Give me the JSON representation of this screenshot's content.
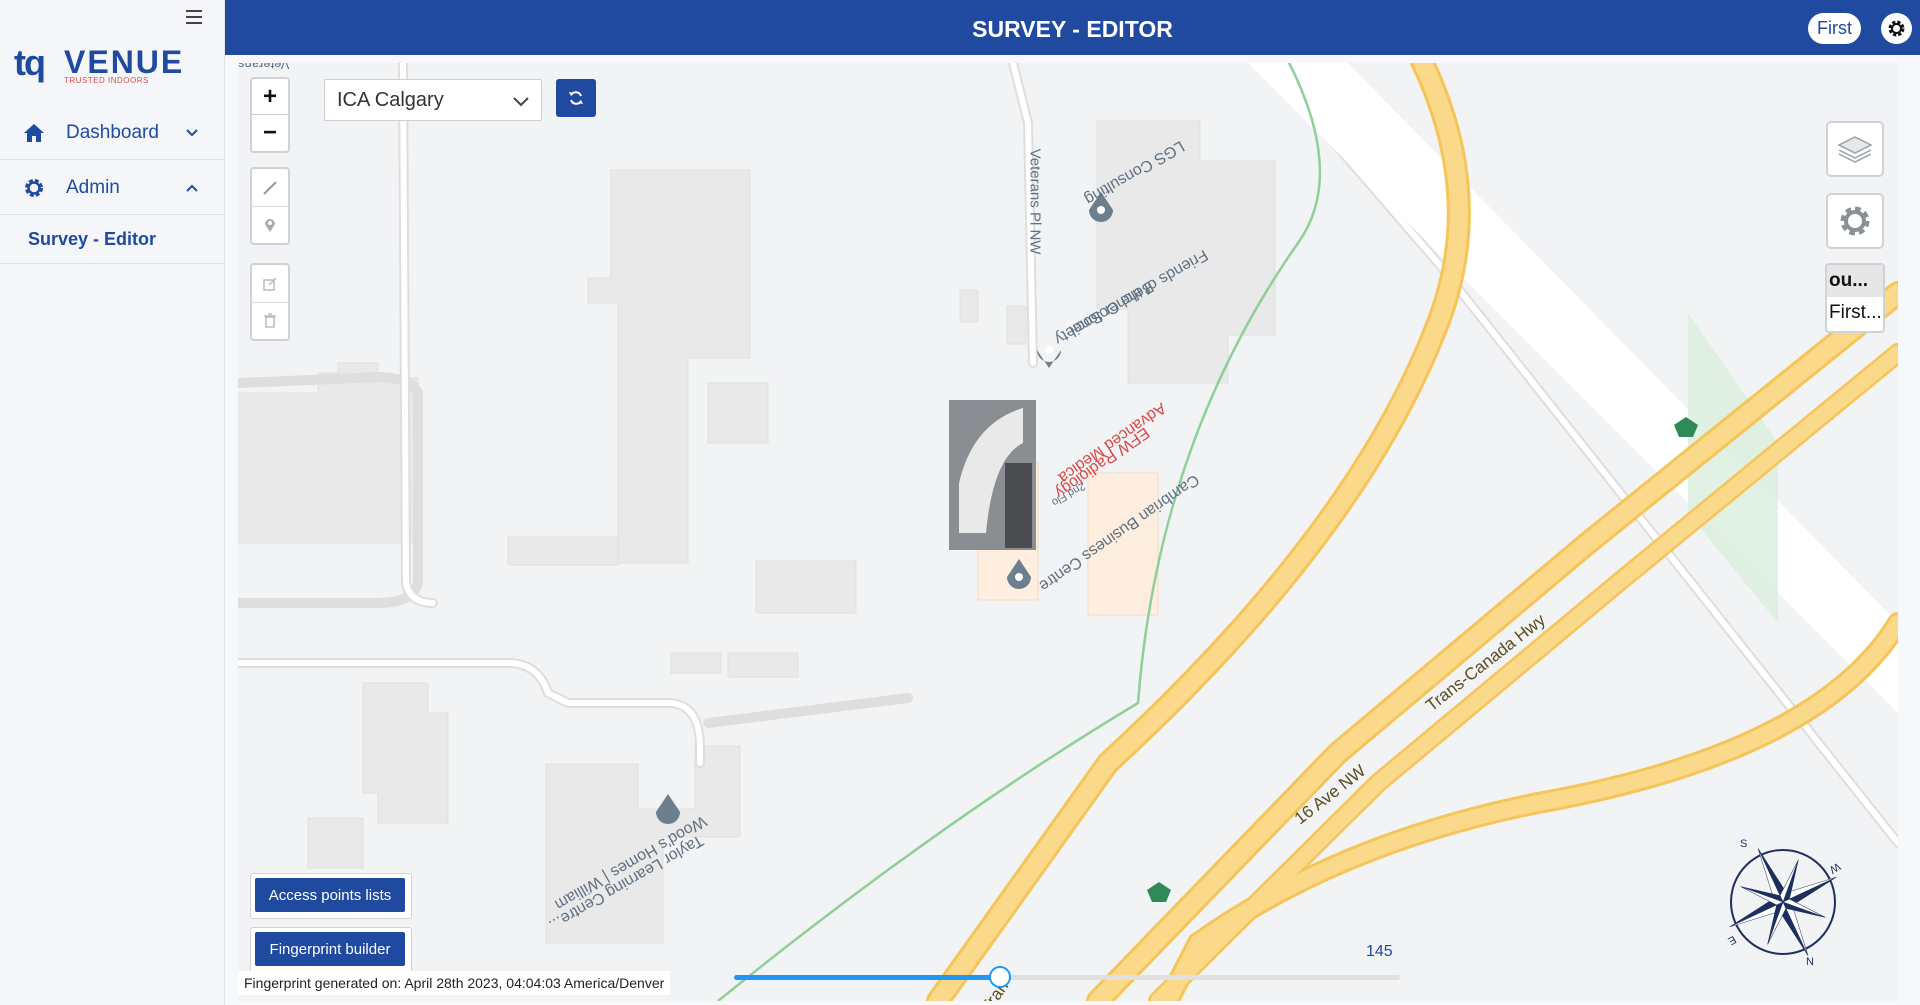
{
  "sidebar": {
    "logo": {
      "mark": "tq",
      "word": "VENUE",
      "tagline": "TRUSTED INDOORS"
    },
    "items": [
      {
        "label": "Dashboard",
        "icon": "home-icon",
        "expanded": false
      },
      {
        "label": "Admin",
        "icon": "gear-icon",
        "expanded": true
      }
    ],
    "sub_items": [
      {
        "label": "Survey - Editor"
      }
    ]
  },
  "header": {
    "title": "SURVEY - EDITOR",
    "floor_pill": "First"
  },
  "map": {
    "venue_select": {
      "value": "ICA Calgary"
    },
    "floor_options": [
      "ou...",
      "First..."
    ],
    "buttons": {
      "access_points": "Access points lists",
      "fingerprint_builder": "Fingerprint builder"
    },
    "fingerprint_note": "Fingerprint generated on: April 28th 2023, 04:04:03 America/Denver",
    "slider": {
      "value": 145,
      "fraction": 0.4
    },
    "labels": {
      "lgs": "LGS Consulting",
      "friends": "Friends of the Colonel",
      "belcher": "Belcher Society",
      "veterans": "Veterans Pl NW",
      "veterans_top": "Veterans",
      "advanced": "Advanced Medica",
      "efw": "EFW Radiology",
      "second_floor": "2nd Flo",
      "cambrian": "Cambrian Business Centre",
      "woods": "Wood's Homes | William",
      "taylor": "Taylor Learning Centre...",
      "ave16": "16 Ave NW",
      "transcanada": "Trans-Canada Hwy",
      "tran": "Tran"
    },
    "compass": {
      "n": "N",
      "s": "S",
      "e": "E",
      "w": "W"
    },
    "colors": {
      "primary": "#1f4aa0",
      "road": "#f9d77d",
      "slider": "#2196f3",
      "poi": "#6b7f8e",
      "highlight": "#d94848"
    }
  }
}
